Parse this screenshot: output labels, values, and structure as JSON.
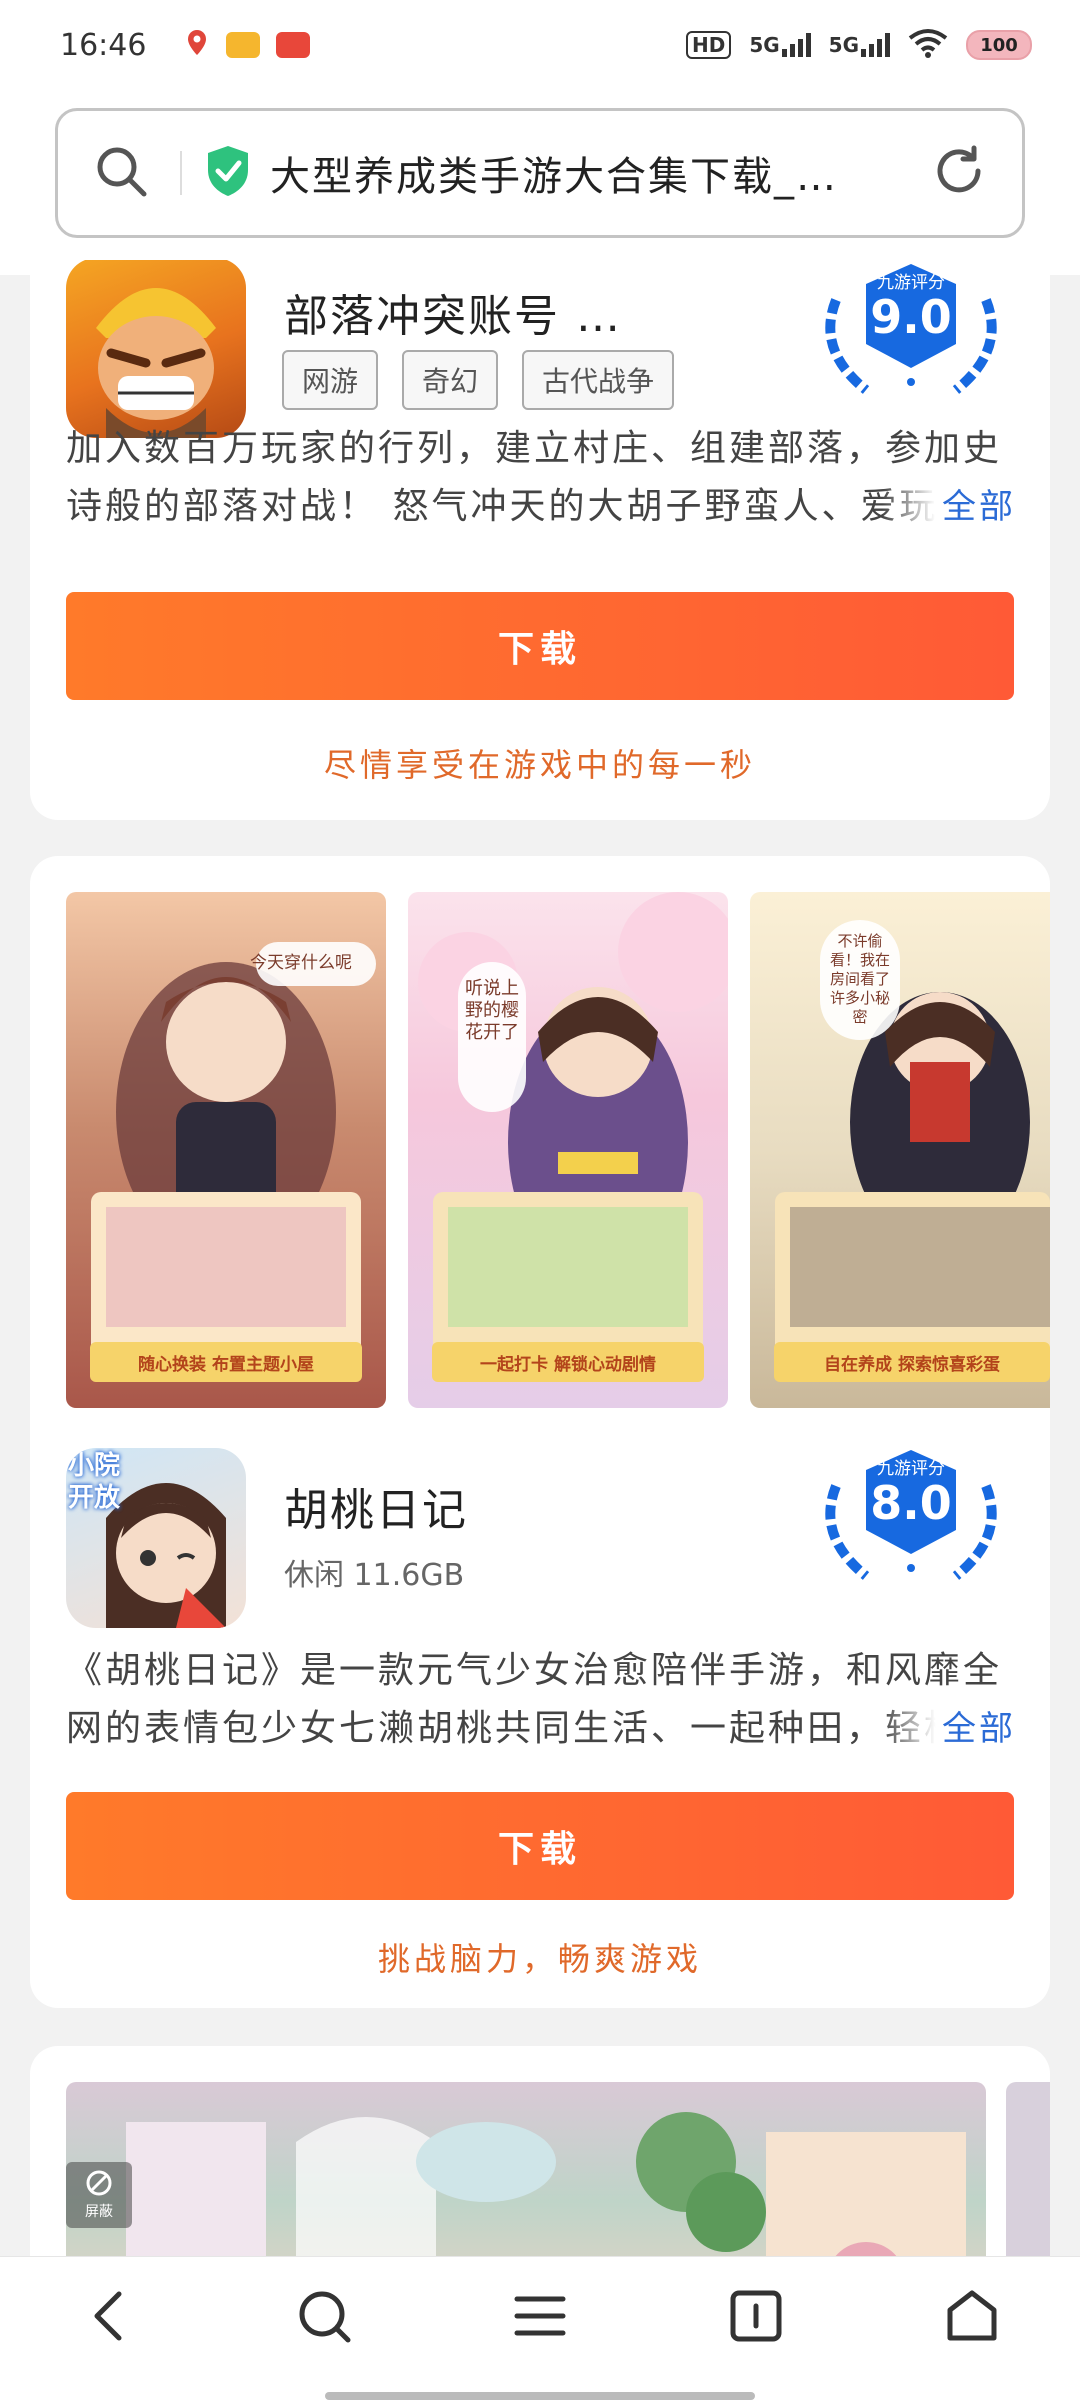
{
  "status_bar": {
    "time": "16:46",
    "network1": "5G",
    "network2": "5G",
    "hd": "HD",
    "battery": "100"
  },
  "address_bar": {
    "page_title": "大型养成类手游大合集下载_…"
  },
  "apps": [
    {
      "name": "部落冲突账号 …",
      "tags": [
        "网游",
        "奇幻",
        "古代战争"
      ],
      "score_label": "九游评分",
      "score": "9.0",
      "description": "加入数百万玩家的行列，建立村庄、组建部落，参加史诗般的部落对战！ 怒气冲天的大胡子野蛮人、爱玩",
      "more_label": "全部",
      "download_label": "下载",
      "slogan": "尽情享受在游戏中的每一秒"
    },
    {
      "name": "胡桃日记",
      "meta": "休闲 11.6GB",
      "score_label": "九游评分",
      "score": "8.0",
      "description": "《胡桃日记》是一款元气少女治愈陪伴手游，和风靡全网的表情包少女七濑胡桃共同生活、一起种田，轻松",
      "more_label": "全部",
      "download_label": "下载",
      "slogan": "挑战脑力，畅爽游戏",
      "screenshots": [
        {
          "bubble": "今天穿什么呢",
          "caption": "随心换装 布置主题小屋"
        },
        {
          "bubble": "听说上野的樱花开了",
          "caption": "一起打卡 解锁心动剧情"
        },
        {
          "bubble": "不许偷看！我在房间看了许多小秘密",
          "caption": "自在养成 探索惊喜彩蛋"
        }
      ],
      "icon_badge": "小院开放"
    }
  ],
  "third_card": {
    "block_label": "屏蔽"
  },
  "colors": {
    "accent_orange": "#ff6a30",
    "score_blue": "#1769e0",
    "link_blue": "#2b6bd6",
    "safe_green": "#2ec27e"
  }
}
